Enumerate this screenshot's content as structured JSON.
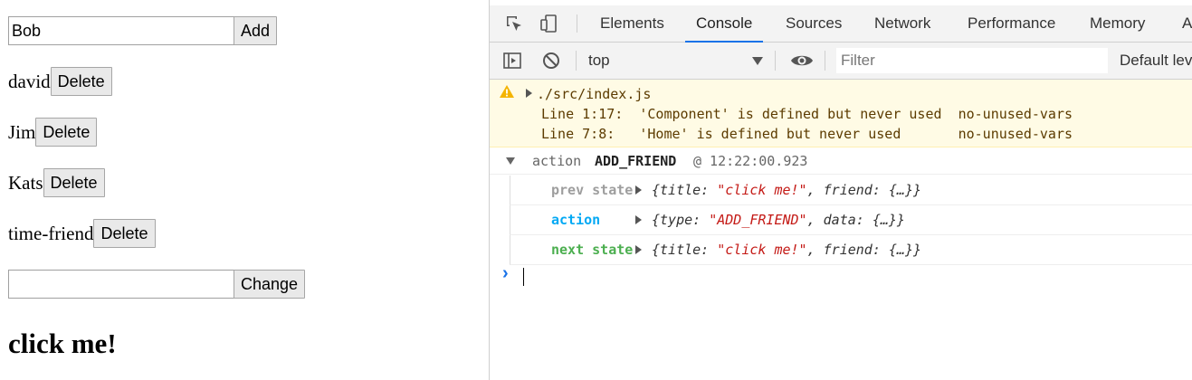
{
  "app": {
    "add_input_value": "Bob",
    "add_button": "Add",
    "friends": [
      {
        "name": "david",
        "delete": "Delete"
      },
      {
        "name": "Jim",
        "delete": "Delete"
      },
      {
        "name": "Kats",
        "delete": "Delete"
      },
      {
        "name": "time-friend",
        "delete": "Delete"
      }
    ],
    "change_input_value": "",
    "change_button": "Change",
    "title": "click me!"
  },
  "devtools": {
    "tabs": [
      "Elements",
      "Console",
      "Sources",
      "Network",
      "Performance",
      "Memory",
      "A"
    ],
    "active_tab": "Console",
    "context": "top",
    "filter_placeholder": "Filter",
    "levels": "Default levels",
    "accent_color": "#1a73e8",
    "warning": {
      "source": "./src/index.js",
      "lines": [
        "Line 1:17:  'Component' is defined but never used  no-unused-vars",
        "Line 7:8:   'Home' is defined but never used       no-unused-vars"
      ]
    },
    "group": {
      "prefix": "action",
      "action_name": "ADD_FRIEND",
      "timestamp": "@ 12:22:00.923"
    },
    "entries": [
      {
        "label": "prev state",
        "color": "#9e9e9e",
        "value_pre": "{title: ",
        "value_str": "\"click me!\"",
        "value_post": ", friend: {…}}"
      },
      {
        "label": "action",
        "color": "#03a9f4",
        "value_pre": "{type: ",
        "value_str": "\"ADD_FRIEND\"",
        "value_post": ", data: {…}}"
      },
      {
        "label": "next state",
        "color": "#4caf50",
        "value_pre": "{title: ",
        "value_str": "\"click me!\"",
        "value_post": ", friend: {…}}"
      }
    ],
    "prompt_symbol": "›"
  }
}
